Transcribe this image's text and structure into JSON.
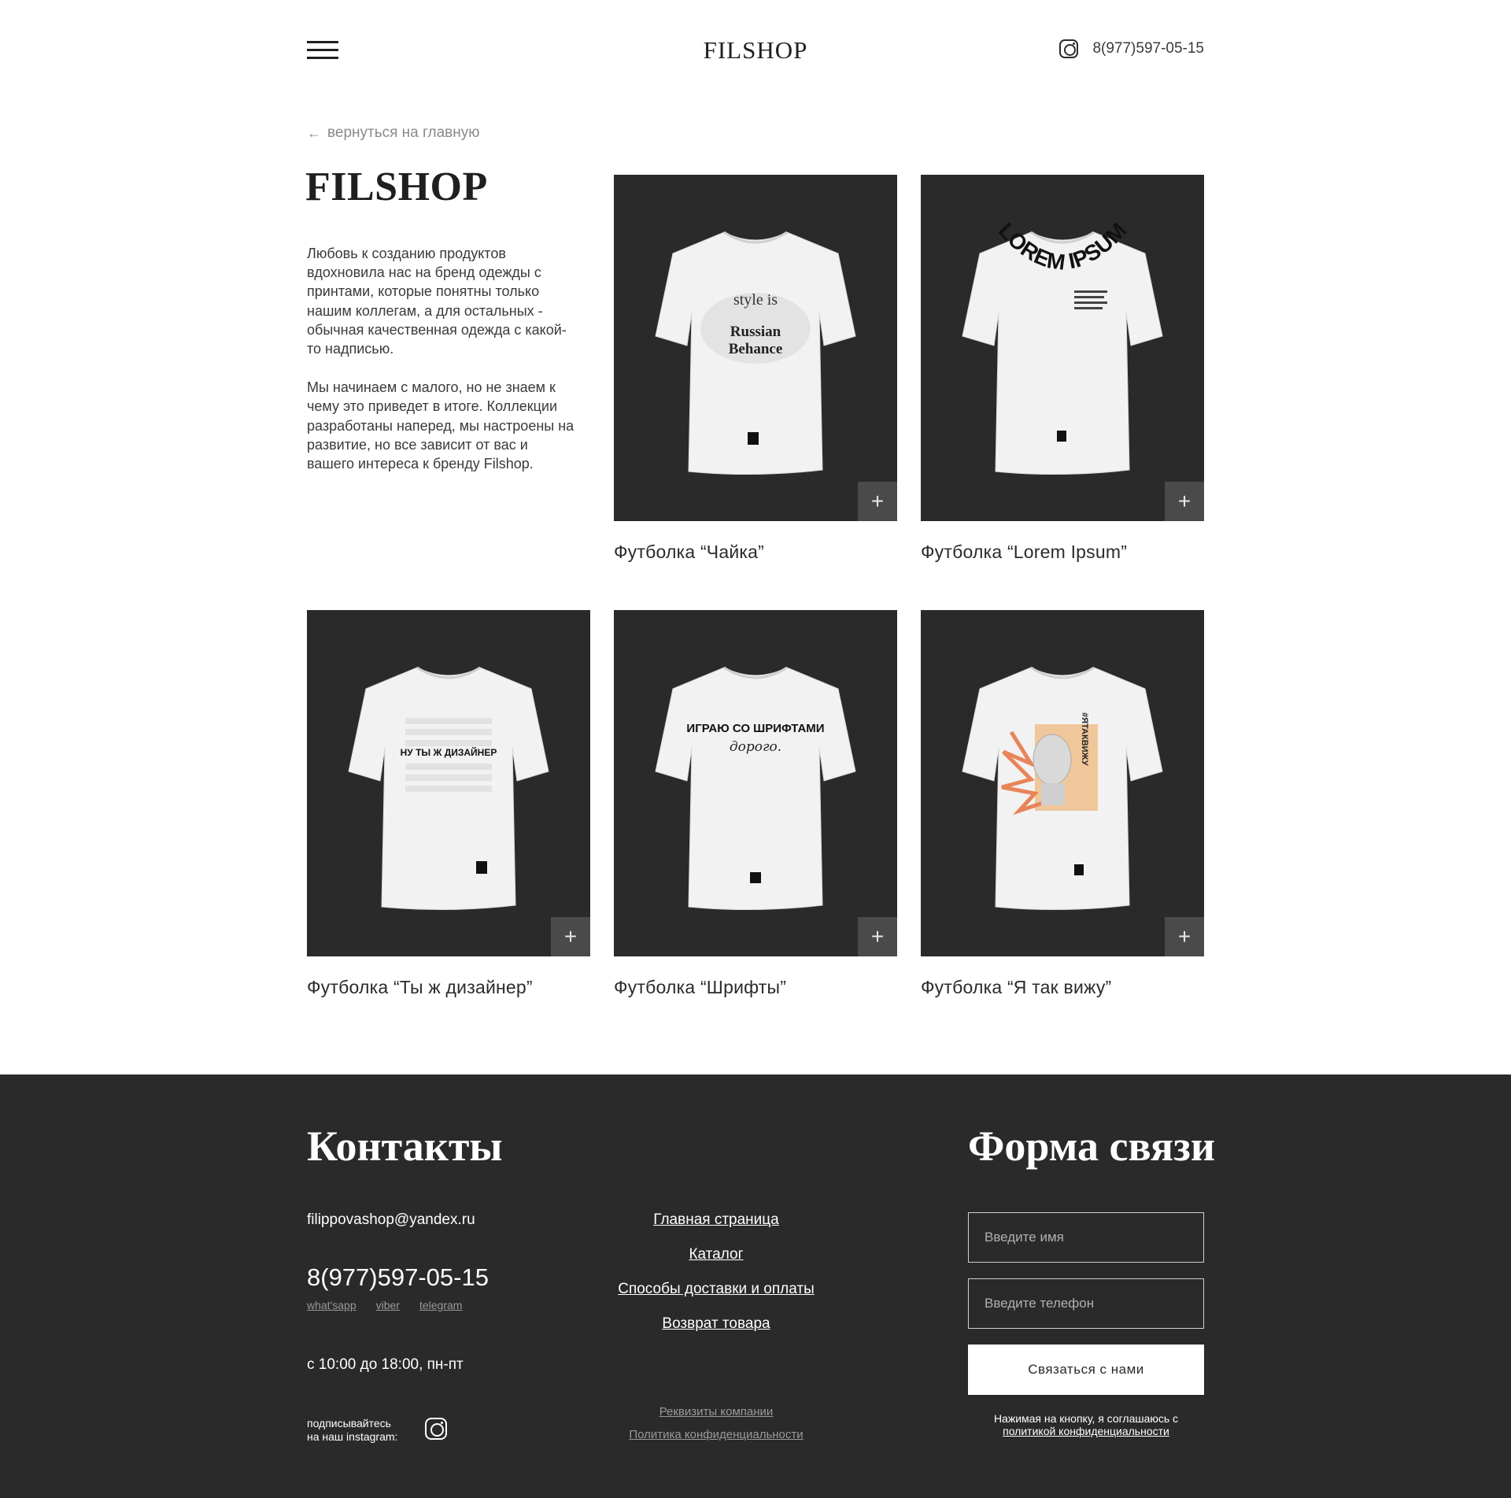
{
  "header": {
    "logo": "FILSHOP",
    "phone": "8(977)597-05-15"
  },
  "back_link": "вернуться на главную",
  "intro": {
    "title": "FILSHOP",
    "paragraph1": "Любовь к созданию продуктов вдохновила нас на бренд одежды с принтами, которые понятны только нашим коллегам, а для остальных - обычная качественная одежда с какой-то надписью.",
    "paragraph2": "Мы начинаем с малого, но не знаем к чему это приведет в итоге. Коллекции разработаны наперед, мы настроены на развитие, но все зависит от вас и вашего интереса к бренду Filshop."
  },
  "products": [
    {
      "name": "Футболка “Чайка”",
      "print_line1": "style is",
      "print_line2": "Russian",
      "print_line3": "Behance",
      "add_label": "+"
    },
    {
      "name": "Футболка “Lorem Ipsum”",
      "print_line1": "LOREM IPSUM",
      "add_label": "+"
    },
    {
      "name": "Футболка “Ты ж дизайнер”",
      "print_line1": "НУ ТЫ Ж ДИЗАЙНЕР",
      "add_label": "+"
    },
    {
      "name": "Футболка “Шрифты”",
      "print_line1": "ИГРАЮ СО ШРИФТАМИ",
      "print_line2": "дорого.",
      "add_label": "+"
    },
    {
      "name": "Футболка “Я так вижу”",
      "print_line1": "#ЯТАКВИЖУ",
      "add_label": "+"
    }
  ],
  "footer": {
    "contacts_title": "Контакты",
    "email": "filippovashop@yandex.ru",
    "phone": "8(977)597-05-15",
    "messengers": [
      "what'sapp",
      "viber",
      "telegram"
    ],
    "hours": "с 10:00 до 18:00, пн-пт",
    "subscribe_line1": "подписывайтесь",
    "subscribe_line2": "на наш instagram:",
    "nav": [
      "Главная страница",
      "Каталог",
      "Способы доставки и оплаты",
      "Возврат товара"
    ],
    "legal": [
      "Реквизиты компании",
      "Политика конфиденциальности"
    ],
    "form_title": "Форма связи",
    "name_placeholder": "Введите имя",
    "phone_placeholder": "Введите телефон",
    "submit_label": "Связаться с нами",
    "consent_text": "Нажимая на кнопку, я соглашаюсь с",
    "consent_link": "политикой конфиденциальности"
  },
  "colors": {
    "dark": "#2a2a2a",
    "button_grey": "#4a4a4a",
    "accent_orange": "#e8845a"
  }
}
